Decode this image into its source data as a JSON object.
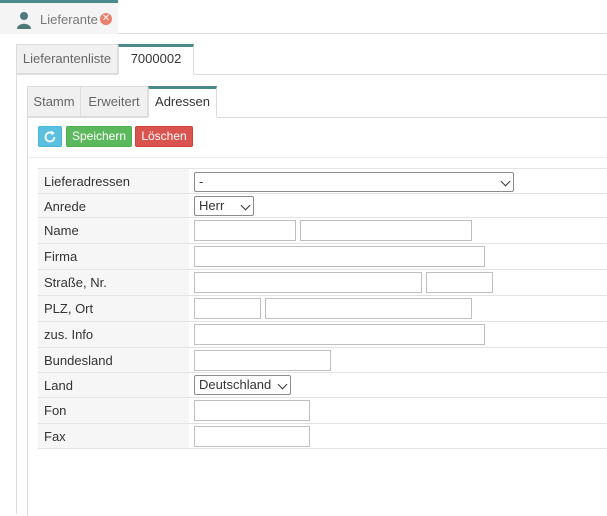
{
  "app_tab": {
    "label": "Lieferanten",
    "icon": "user-icon",
    "close_icon": "close-icon"
  },
  "tabs_level1": [
    {
      "label": "Lieferantenliste",
      "active": false
    },
    {
      "label": "7000002",
      "active": true
    }
  ],
  "tabs_level2": [
    {
      "label": "Stamm",
      "active": false
    },
    {
      "label": "Erweitert",
      "active": false
    },
    {
      "label": "Adressen",
      "active": true
    }
  ],
  "toolbar": {
    "refresh_icon": "refresh-icon",
    "save_label": "Speichern",
    "delete_label": "Löschen"
  },
  "colors": {
    "accent": "#4a8a8a",
    "refresh": "#5bc0de",
    "save": "#5cb85c",
    "delete": "#d9534f"
  },
  "form": {
    "lieferadressen": {
      "label": "Lieferadressen",
      "selected": "-"
    },
    "anrede": {
      "label": "Anrede",
      "selected": "Herr"
    },
    "name": {
      "label": "Name",
      "first": "",
      "last": ""
    },
    "firma": {
      "label": "Firma",
      "value": ""
    },
    "strasse": {
      "label": "Straße, Nr.",
      "street": "",
      "number": ""
    },
    "plz_ort": {
      "label": "PLZ, Ort",
      "plz": "",
      "ort": ""
    },
    "zus_info": {
      "label": "zus. Info",
      "value": ""
    },
    "bundesland": {
      "label": "Bundesland",
      "value": ""
    },
    "land": {
      "label": "Land",
      "selected": "Deutschland"
    },
    "fon": {
      "label": "Fon",
      "value": ""
    },
    "fax": {
      "label": "Fax",
      "value": ""
    }
  }
}
